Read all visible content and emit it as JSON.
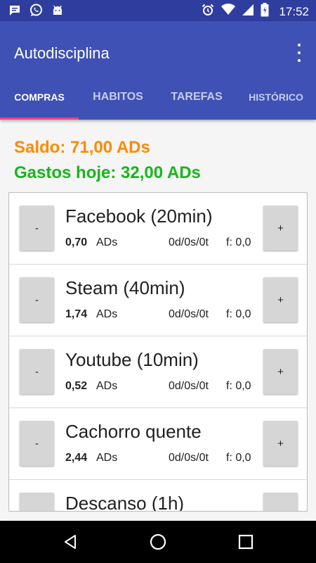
{
  "status_bar": {
    "time": "17:52",
    "left_icons": [
      "message-icon",
      "whatsapp-icon",
      "android-icon"
    ],
    "right_icons": [
      "alarm-icon",
      "wifi-icon",
      "signal-icon",
      "battery-icon"
    ]
  },
  "app_bar": {
    "title": "Autodisciplina",
    "color": "#3f51b5"
  },
  "tabs": [
    {
      "label": "COMPRAS",
      "active": true
    },
    {
      "label": "HABITOS",
      "active": false
    },
    {
      "label": "TAREFAS",
      "active": false
    },
    {
      "label": "HISTÓRICO",
      "active": false
    }
  ],
  "summary": {
    "saldo": "Saldo: 71,00 ADs",
    "gastos": "Gastos hoje: 32,00 ADs"
  },
  "items": [
    {
      "name": "Facebook (20min)",
      "value": "0,70",
      "unit": "ADs",
      "counts": "0d/0s/0t",
      "freq": "f: 0,0",
      "minus": "-",
      "plus": "+"
    },
    {
      "name": "Steam (40min)",
      "value": "1,74",
      "unit": "ADs",
      "counts": "0d/0s/0t",
      "freq": "f: 0,0",
      "minus": "-",
      "plus": "+"
    },
    {
      "name": "Youtube (10min)",
      "value": "0,52",
      "unit": "ADs",
      "counts": "0d/0s/0t",
      "freq": "f: 0,0",
      "minus": "-",
      "plus": "+"
    },
    {
      "name": "Cachorro quente",
      "value": "2,44",
      "unit": "ADs",
      "counts": "0d/0s/0t",
      "freq": "f: 0,0",
      "minus": "-",
      "plus": "+"
    },
    {
      "name": "Descanso (1h)",
      "value": "",
      "unit": "",
      "counts": "",
      "freq": "",
      "minus": "-",
      "plus": "+"
    }
  ],
  "nav": [
    "back-icon",
    "home-icon",
    "recents-icon"
  ]
}
